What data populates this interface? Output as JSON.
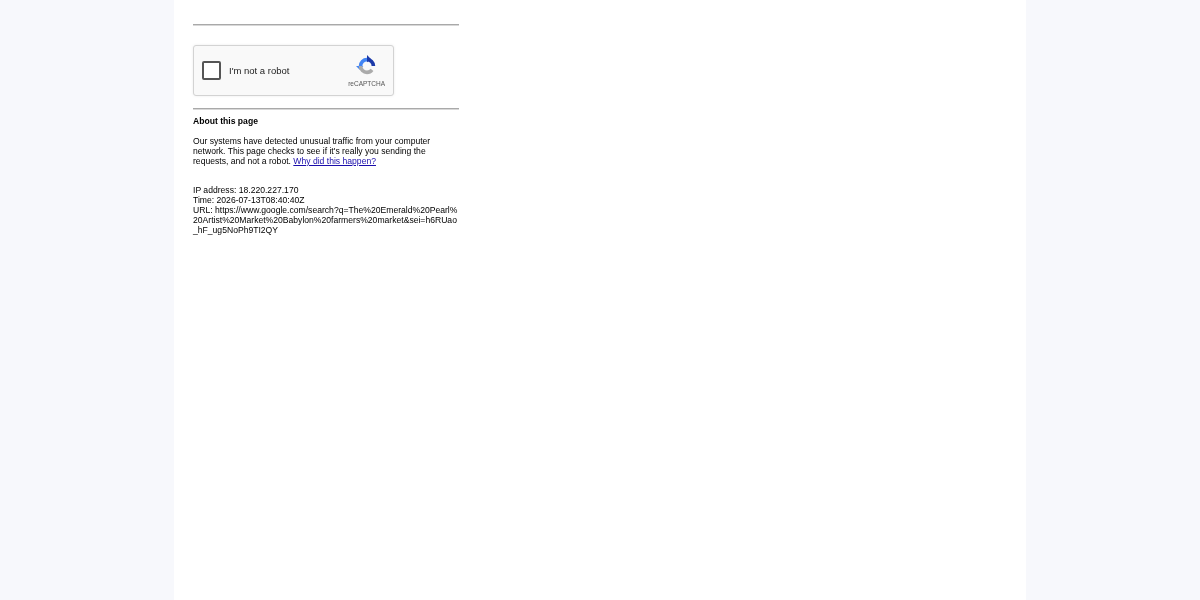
{
  "captcha": {
    "label": "I'm not a robot",
    "checked": false,
    "brand": "reCAPTCHA"
  },
  "about": {
    "heading": "About this page",
    "text": "Our systems have detected unusual traffic from your computer network. This page checks to see if it's really you sending the requests, and not a robot. ",
    "link": "Why did this happen?"
  },
  "details": [
    "IP address: 18.220.227.170",
    "Time: 2026-07-13T08:40:40Z",
    "URL: https://www.google.com/search?q=The%20Emerald%20Pearl%20Artist%20Market%20Babylon%20farmers%20market&sei=h6RUao_hF_ug5NoPh9TI2QY"
  ]
}
